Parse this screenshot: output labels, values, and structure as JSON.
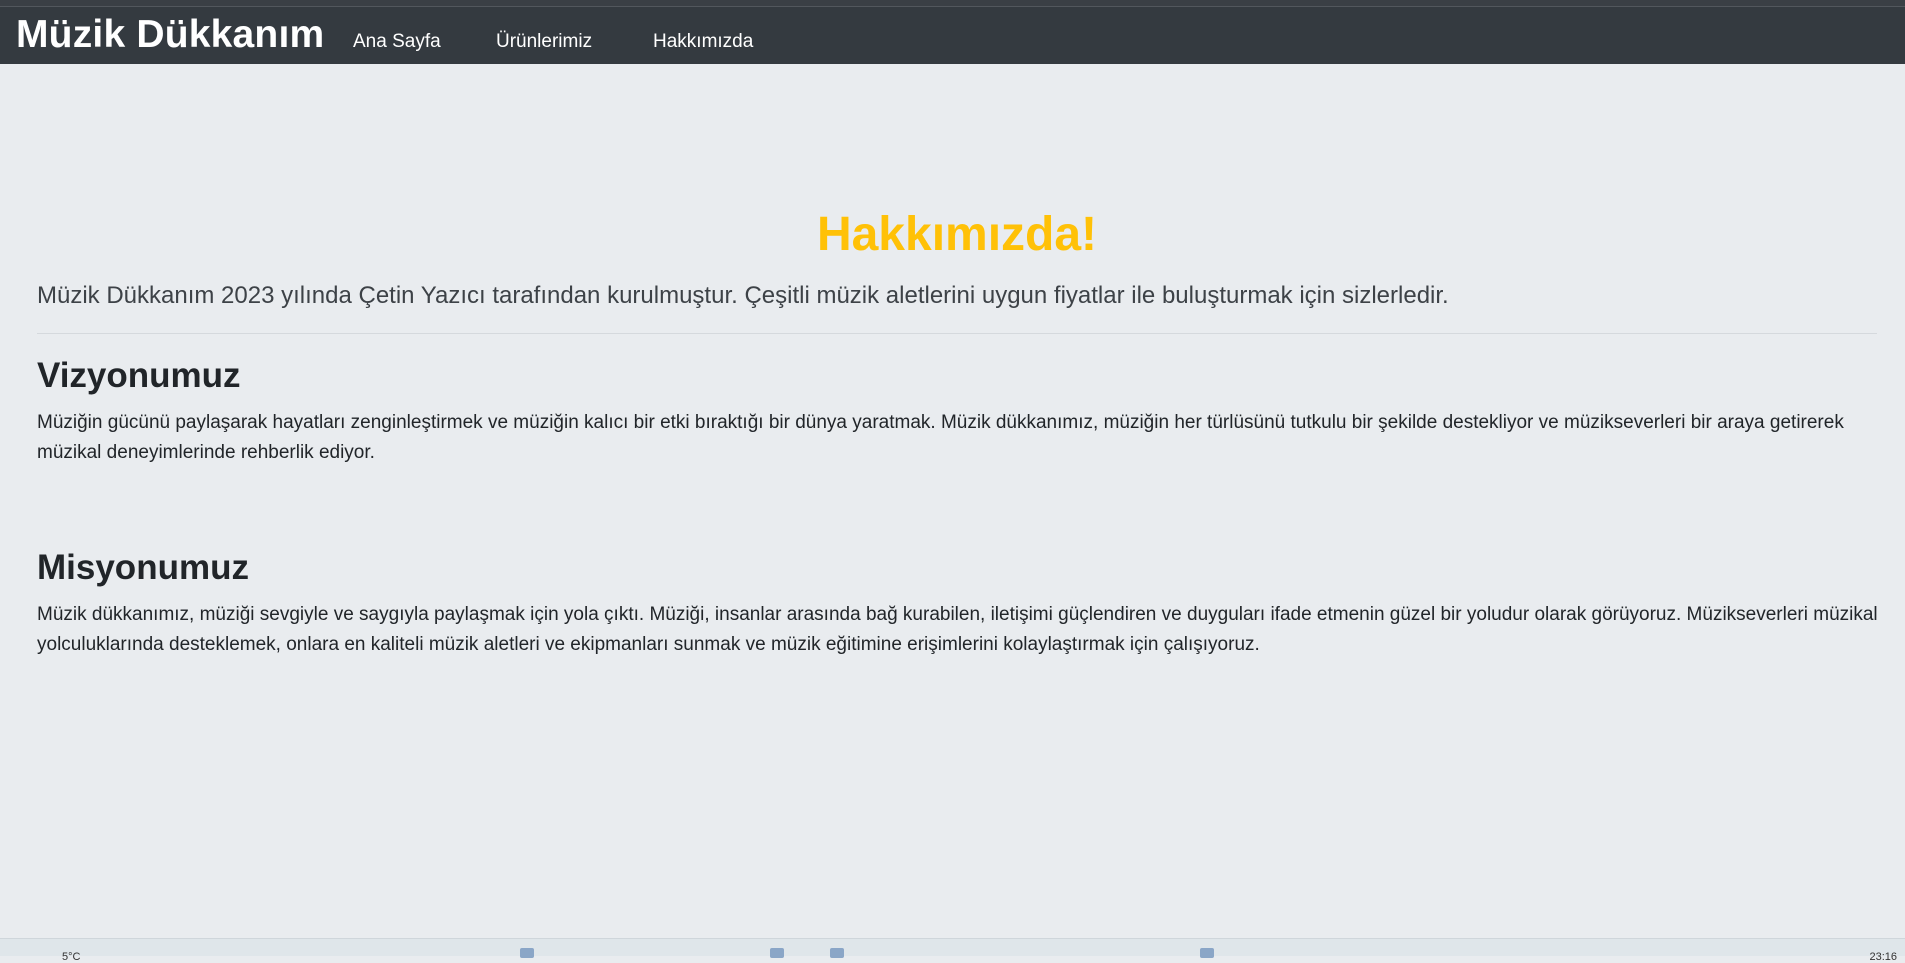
{
  "navbar": {
    "brand": "Müzik Dükkanım",
    "links": [
      "Ana Sayfa",
      "Ürünlerimiz",
      "Hakkımızda"
    ]
  },
  "hero": {
    "title": "Hakkımızda!",
    "lead": "Müzik Dükkanım 2023 yılında Çetin Yazıcı tarafından kurulmuştur. Çeşitli müzik aletlerini uygun fiyatlar ile buluşturmak için sizlerledir."
  },
  "vision": {
    "heading": "Vizyonumuz",
    "text": "Müziğin gücünü paylaşarak hayatları zenginleştirmek ve müziğin kalıcı bir etki bıraktığı bir dünya yaratmak. Müzik dükkanımız, müziğin her türlüsünü tutkulu bir şekilde destekliyor ve müzikseverleri bir araya getirerek müzikal deneyimlerinde rehberlik ediyor."
  },
  "mission": {
    "heading": "Misyonumuz",
    "text": "Müzik dükkanımız, müziği sevgiyle ve saygıyla paylaşmak için yola çıktı. Müziği, insanlar arasında bağ kurabilen, iletişimi güçlendiren ve duyguları ifade etmenin güzel bir yoludur olarak görüyoruz. Müzikseverleri müzikal yolculuklarında desteklemek, onlara en kaliteli müzik aletleri ve ekipmanları sunmak ve müzik eğitimine erişimlerini kolaylaştırmak için çalışıyoruz."
  },
  "taskbar": {
    "weather": "5°C",
    "clock": "23:16"
  },
  "colors": {
    "navbar": "#343a40",
    "page_background": "#e9ecef",
    "accent": "#ffc107"
  }
}
